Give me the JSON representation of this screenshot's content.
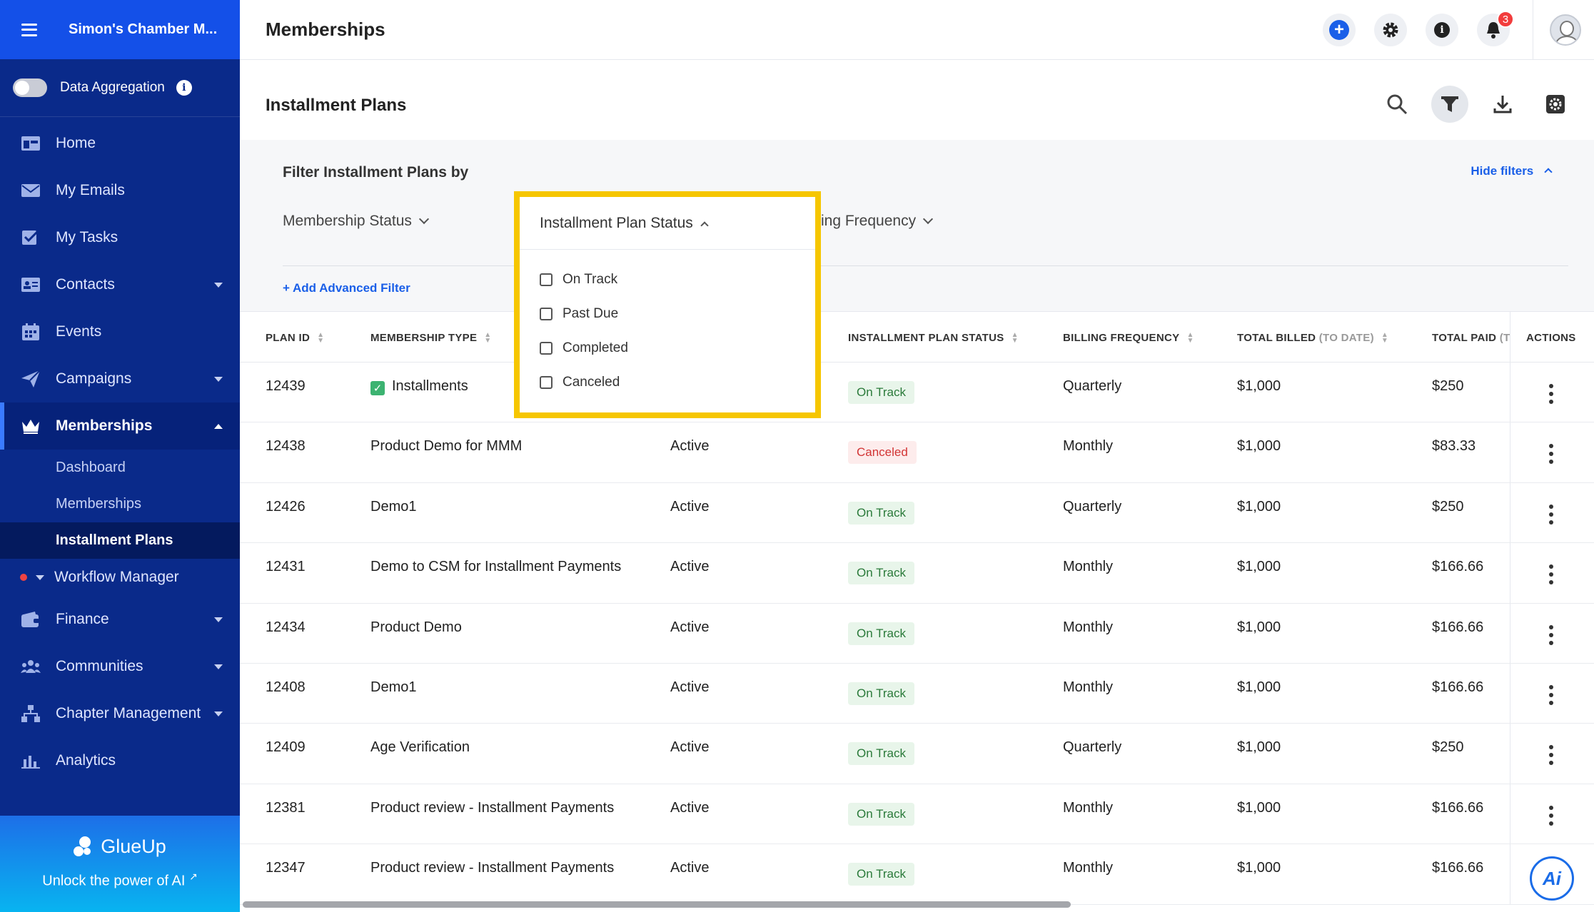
{
  "sidebar": {
    "org_name": "Simon's Chamber M...",
    "data_aggregation_label": "Data Aggregation",
    "nav": [
      {
        "label": "Home",
        "icon": "home-icon"
      },
      {
        "label": "My Emails",
        "icon": "email-icon"
      },
      {
        "label": "My Tasks",
        "icon": "tasks-icon"
      },
      {
        "label": "Contacts",
        "icon": "contacts-icon"
      },
      {
        "label": "Events",
        "icon": "calendar-icon"
      },
      {
        "label": "Campaigns",
        "icon": "paper-plane-icon"
      },
      {
        "label": "Memberships",
        "icon": "crown-icon"
      }
    ],
    "membership_sub": [
      "Dashboard",
      "Memberships",
      "Installment Plans"
    ],
    "workflow_label": "Workflow Manager",
    "nav_bottom": [
      {
        "label": "Finance",
        "icon": "wallet-icon"
      },
      {
        "label": "Communities",
        "icon": "community-icon"
      },
      {
        "label": "Chapter Management",
        "icon": "hierarchy-icon"
      },
      {
        "label": "Analytics",
        "icon": "bar-chart-icon"
      }
    ],
    "brand": "GlueUp",
    "unlock_ai": "Unlock the power of AI"
  },
  "header": {
    "title": "Memberships",
    "notification_count": "3"
  },
  "section": {
    "title": "Installment Plans"
  },
  "filters": {
    "heading": "Filter Installment Plans by",
    "hide_label": "Hide filters",
    "membership_status": "Membership Status",
    "billing_frequency_partial": "ing Frequency",
    "add_advanced": "+ Add Advanced Filter"
  },
  "dropdown": {
    "title": "Installment Plan Status",
    "options": [
      "On Track",
      "Past Due",
      "Completed",
      "Canceled"
    ]
  },
  "table": {
    "headers": {
      "plan_id": "PLAN ID",
      "membership_type": "MEMBERSHIP TYPE",
      "plan_status": "INSTALLMENT PLAN STATUS",
      "billing_frequency": "BILLING FREQUENCY",
      "total_billed": "TOTAL BILLED",
      "total_billed_suffix": "(TO DATE)",
      "total_paid": "TOTAL PAID",
      "total_paid_suffix": "(T",
      "actions": "ACTIONS"
    },
    "rows": [
      {
        "id": "12439",
        "type": "Installments",
        "membership_status": "",
        "status": "On Track",
        "frequency": "Quarterly",
        "billed": "$1,000",
        "paid": "$250"
      },
      {
        "id": "12438",
        "type": "Product Demo for MMM",
        "membership_status": "Active",
        "status": "Canceled",
        "frequency": "Monthly",
        "billed": "$1,000",
        "paid": "$83.33"
      },
      {
        "id": "12426",
        "type": "Demo1",
        "membership_status": "Active",
        "status": "On Track",
        "frequency": "Quarterly",
        "billed": "$1,000",
        "paid": "$250"
      },
      {
        "id": "12431",
        "type": "Demo to CSM for Installment Payments",
        "membership_status": "Active",
        "status": "On Track",
        "frequency": "Monthly",
        "billed": "$1,000",
        "paid": "$166.66"
      },
      {
        "id": "12434",
        "type": "Product Demo",
        "membership_status": "Active",
        "status": "On Track",
        "frequency": "Monthly",
        "billed": "$1,000",
        "paid": "$166.66"
      },
      {
        "id": "12408",
        "type": "Demo1",
        "membership_status": "Active",
        "status": "On Track",
        "frequency": "Monthly",
        "billed": "$1,000",
        "paid": "$166.66"
      },
      {
        "id": "12409",
        "type": "Age Verification",
        "membership_status": "Active",
        "status": "On Track",
        "frequency": "Quarterly",
        "billed": "$1,000",
        "paid": "$250"
      },
      {
        "id": "12381",
        "type": "Product review - Installment Payments",
        "membership_status": "Active",
        "status": "On Track",
        "frequency": "Monthly",
        "billed": "$1,000",
        "paid": "$166.66"
      },
      {
        "id": "12347",
        "type": "Product review - Installment Payments",
        "membership_status": "Active",
        "status": "On Track",
        "frequency": "Monthly",
        "billed": "$1,000",
        "paid": "$166.66"
      }
    ]
  },
  "ai_button_label": "Ai",
  "colors": {
    "sidebar_bg": "#0a2a8a",
    "brand_blue": "#1a5fe8",
    "highlight": "#f6c600",
    "on_track": "#2a7a3a",
    "canceled": "#d23434"
  }
}
